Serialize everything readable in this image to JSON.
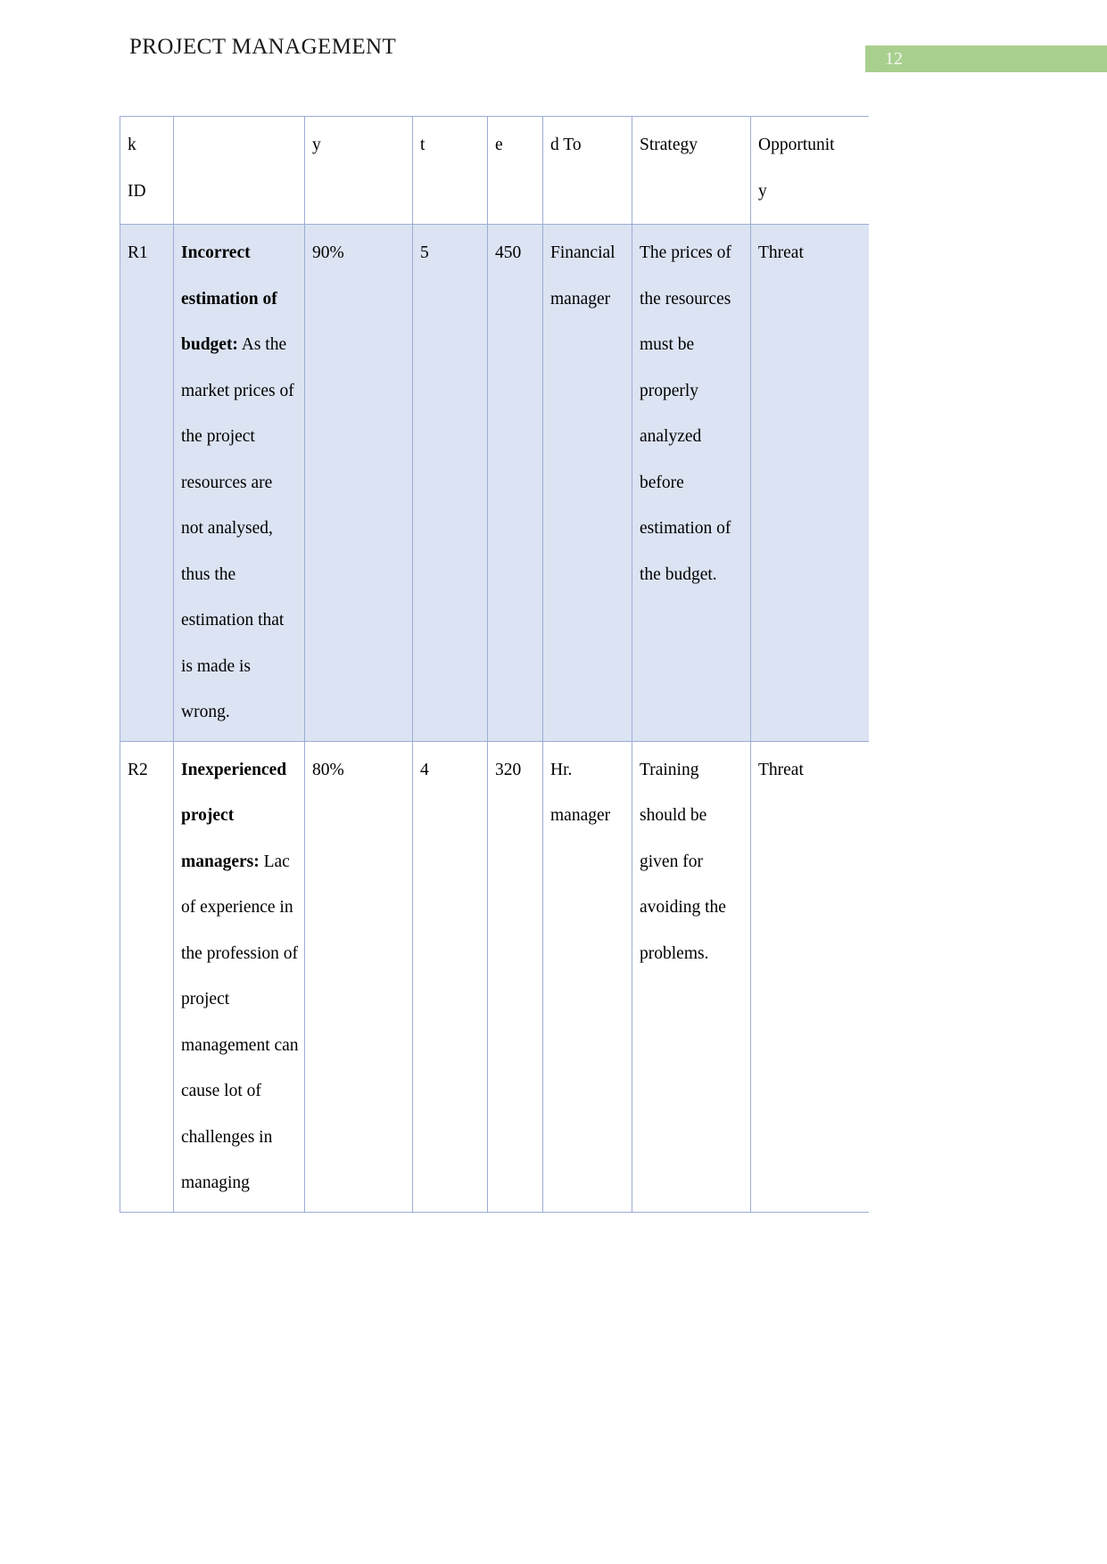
{
  "header": {
    "document_title": "PROJECT MANAGEMENT",
    "page_number": "12",
    "badge_color": "#a9cf8f"
  },
  "table": {
    "name": "risk-register-table",
    "border_color": "#9badd4",
    "shaded_row_color": "#dce3f2",
    "columns": [
      {
        "key": "risk_id",
        "header_line1": "k",
        "header_line2": "ID"
      },
      {
        "key": "description",
        "header_line1": "",
        "header_line2": ""
      },
      {
        "key": "probability",
        "header_line1": "y",
        "header_line2": ""
      },
      {
        "key": "impact",
        "header_line1": "t",
        "header_line2": ""
      },
      {
        "key": "score",
        "header_line1": "e",
        "header_line2": ""
      },
      {
        "key": "assigned_to",
        "header_line1": "d To",
        "header_line2": ""
      },
      {
        "key": "strategy",
        "header_line1": "Strategy",
        "header_line2": ""
      },
      {
        "key": "opportunity",
        "header_line1": "Opportunit",
        "header_line2": "y"
      }
    ],
    "rows": [
      {
        "shaded": true,
        "risk_id": "R1",
        "description_bold": "Incorrect estimation of budget:",
        "description_rest": " As the market prices of the project resources are not analysed, thus the estimation that is made is wrong.",
        "probability": "90%",
        "impact": "5",
        "score": "450",
        "assigned_to": "Financial manager",
        "strategy": "The prices of the resources must be properly analyzed before estimation of the budget.",
        "opportunity": "Threat"
      },
      {
        "shaded": false,
        "risk_id": "R2",
        "description_bold": "Inexperienced project managers:",
        "description_rest": " Lac of experience in the profession of project management can cause lot of challenges in managing",
        "probability": "80%",
        "impact": "4",
        "score": "320",
        "assigned_to": "Hr. manager",
        "strategy": "Training should be given for avoiding the problems.",
        "opportunity": "Threat"
      }
    ]
  }
}
